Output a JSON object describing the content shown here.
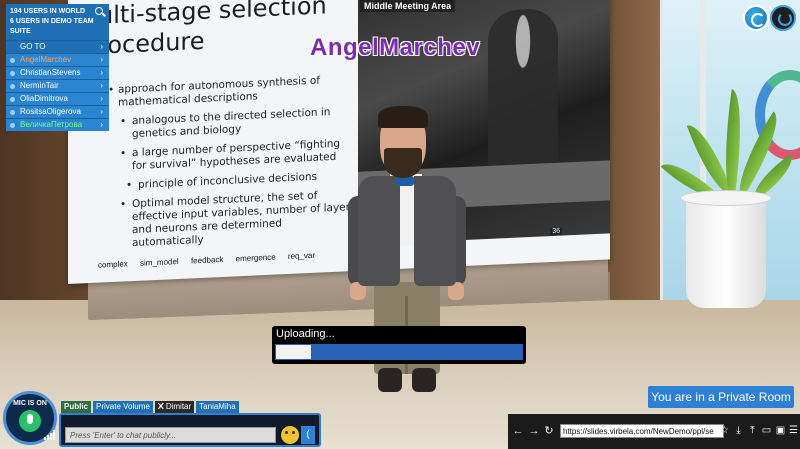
{
  "scene": {
    "area_label": "Middle Meeting Area",
    "speaker_name": "AngelMarchev",
    "slide": {
      "title_line1": "ulti-stage selection",
      "title_line2": "rocedure",
      "bullets": [
        {
          "text": "approach for autonomous  synthesis of mathematical descriptions",
          "level": 1
        },
        {
          "text": "analogous to the directed selection in genetics and biology",
          "level": 2
        },
        {
          "text": "a large number of perspective “fighting for survival” hypotheses are evaluated",
          "level": 2
        },
        {
          "text": "principle of inconclusive decisions",
          "level": 3
        },
        {
          "text": "Optimal model structure, the set of effective input variables, number of layers and neurons are determined automatically",
          "level": 2
        }
      ],
      "footer_items": [
        "complex",
        "sim_model",
        "feedback",
        "emergence",
        "req_var"
      ],
      "page_number": "36"
    }
  },
  "user_panel": {
    "stats_world": "194 USERS IN WORLD",
    "stats_suite": "6 USERS IN DEMO TEAM SUITE",
    "goto_label": "GO TO",
    "users": [
      {
        "name": "AngelMarchev",
        "color": "#f2a76b"
      },
      {
        "name": "ChristianStevens",
        "color": "#ffffff"
      },
      {
        "name": "NerminTair",
        "color": "#ffffff"
      },
      {
        "name": "OliaDimitrova",
        "color": "#ffffff"
      },
      {
        "name": "RositsaOligerova",
        "color": "#ffffff"
      },
      {
        "name": "ВеличкаПетрова",
        "color": "#7dff7d"
      }
    ],
    "search_icon": "search-icon"
  },
  "top_right": {
    "logo_icon": "app-logo-icon",
    "power_icon": "power-icon"
  },
  "upload": {
    "label": "Uploading...",
    "progress": 0.15
  },
  "private_room": {
    "text": "You are in a Private Room"
  },
  "mic": {
    "label": "MIC IS ON",
    "icon": "microphone-icon",
    "signal_icon": "signal-strength-icon"
  },
  "chat": {
    "tabs": [
      {
        "label": "Public",
        "active": true
      },
      {
        "label": "Private Volume",
        "active": false
      },
      {
        "label": "Dimitar",
        "active": false,
        "closable": true
      },
      {
        "label": "TaniaMiha",
        "active": false
      }
    ],
    "placeholder": "Press 'Enter' to chat publicly...",
    "emoji_icon": "smiley-icon",
    "expand_label": "("
  },
  "browser": {
    "url": "https://slides.virbela.com/NewDemo/ppl/se",
    "icons": [
      "back-icon",
      "forward-icon",
      "refresh-icon",
      "star-icon",
      "download-icon",
      "upload-icon",
      "present-icon",
      "video-icon",
      "menu-icon"
    ]
  },
  "colors": {
    "accent": "#2f7fd4",
    "panel": "#2b84d0",
    "speaker_name": "#7a2bb0"
  }
}
